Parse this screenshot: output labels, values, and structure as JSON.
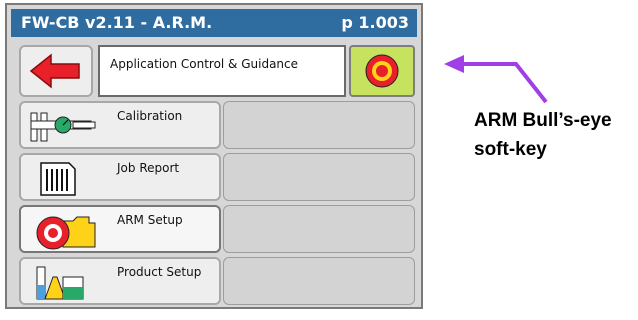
{
  "titlebar": {
    "left": "FW-CB v2.11 - A.R.M.",
    "right": "p 1.003"
  },
  "header": {
    "back_icon": "red-left-arrow-icon",
    "title": "Application Control & Guidance",
    "bullseye_icon": "bullseye-icon"
  },
  "menu": [
    {
      "label": "Calibration",
      "icon": "calibration-caliper-icon"
    },
    {
      "label": "Job Report",
      "icon": "job-report-ledger-icon"
    },
    {
      "label": "ARM Setup",
      "icon": "arm-setup-bullseye-folder-icon"
    },
    {
      "label": "Product Setup",
      "icon": "product-setup-beakers-icon"
    }
  ],
  "annotation": {
    "line1": "ARM Bull’s-eye",
    "line2": "soft-key"
  },
  "colors": {
    "titlebar": "#2f6da1",
    "bullseye_bg": "#c6e25e",
    "arrow": "#a13fe6",
    "red": "#e8202a"
  }
}
